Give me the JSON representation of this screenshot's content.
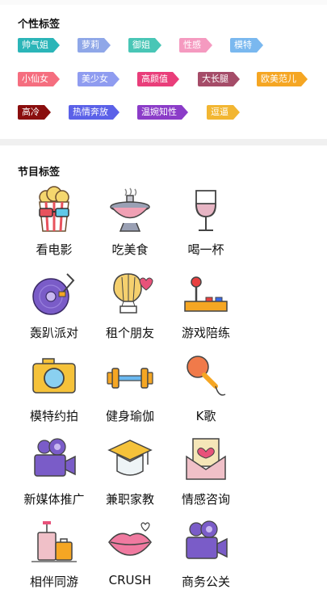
{
  "personality": {
    "title": "个性标签",
    "tags": [
      {
        "label": "帅气姐",
        "color": "#2bb5b8"
      },
      {
        "label": "萝莉",
        "color": "#8fa7e8"
      },
      {
        "label": "御姐",
        "color": "#49c6b6"
      },
      {
        "label": "性感",
        "color": "#f59ac0"
      },
      {
        "label": "模特",
        "color": "#7ab8ef"
      },
      {
        "label": "小仙女",
        "color": "#f56e7f"
      },
      {
        "label": "美少女",
        "color": "#8f9cf0"
      },
      {
        "label": "高颜值",
        "color": "#e93e7a"
      },
      {
        "label": "大长腿",
        "color": "#a54c68"
      },
      {
        "label": "欧美范儿",
        "color": "#f5a623"
      },
      {
        "label": "高冷",
        "color": "#8a0e0e"
      },
      {
        "label": "热情奔放",
        "color": "#5b61e8"
      },
      {
        "label": "温婉知性",
        "color": "#8b3cc8"
      },
      {
        "label": "逗逼",
        "color": "#f2b632"
      }
    ]
  },
  "programs": {
    "title": "节目标签",
    "items": [
      {
        "label": "看电影",
        "icon": "popcorn-3d-glasses-icon"
      },
      {
        "label": "吃美食",
        "icon": "hotpot-icon"
      },
      {
        "label": "喝一杯",
        "icon": "wine-glass-icon"
      },
      {
        "label": "轰趴派对",
        "icon": "vinyl-record-icon"
      },
      {
        "label": "租个朋友",
        "icon": "hot-air-balloon-icon"
      },
      {
        "label": "游戏陪练",
        "icon": "arcade-joystick-icon"
      },
      {
        "label": "模特约拍",
        "icon": "camera-icon"
      },
      {
        "label": "健身瑜伽",
        "icon": "dumbbell-icon"
      },
      {
        "label": "K歌",
        "icon": "microphone-icon"
      },
      {
        "label": "新媒体推广",
        "icon": "video-camera-icon"
      },
      {
        "label": "兼职家教",
        "icon": "graduation-cap-icon"
      },
      {
        "label": "情感咨询",
        "icon": "love-letter-icon"
      },
      {
        "label": "相伴同游",
        "icon": "luggage-icon"
      },
      {
        "label": "CRUSH",
        "icon": "lips-icon"
      },
      {
        "label": "商务公关",
        "icon": "video-camera-icon"
      }
    ]
  }
}
